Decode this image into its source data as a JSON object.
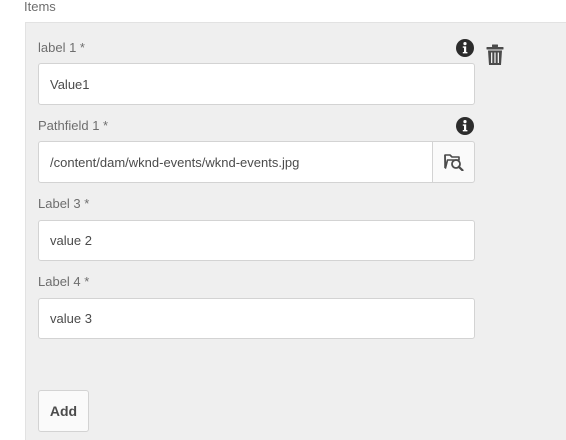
{
  "section": {
    "title": "Items"
  },
  "item": {
    "field1": {
      "label": "label 1 *",
      "value": "Value1"
    },
    "field2": {
      "label": "Pathfield 1 *",
      "value": "/content/dam/wknd-events/wknd-events.jpg"
    },
    "field3": {
      "label": "Label 3 *",
      "value": "value 2"
    },
    "field4": {
      "label": "Label 4 *",
      "value": "value 3"
    }
  },
  "add_button": {
    "label": "Add"
  },
  "icons": {
    "info": "info-icon",
    "delete": "trash-icon",
    "browse": "folder-search-icon"
  },
  "colors": {
    "panel_bg": "#efefef",
    "field_border": "#d3d3d3",
    "icon": "#2c2c2c"
  }
}
